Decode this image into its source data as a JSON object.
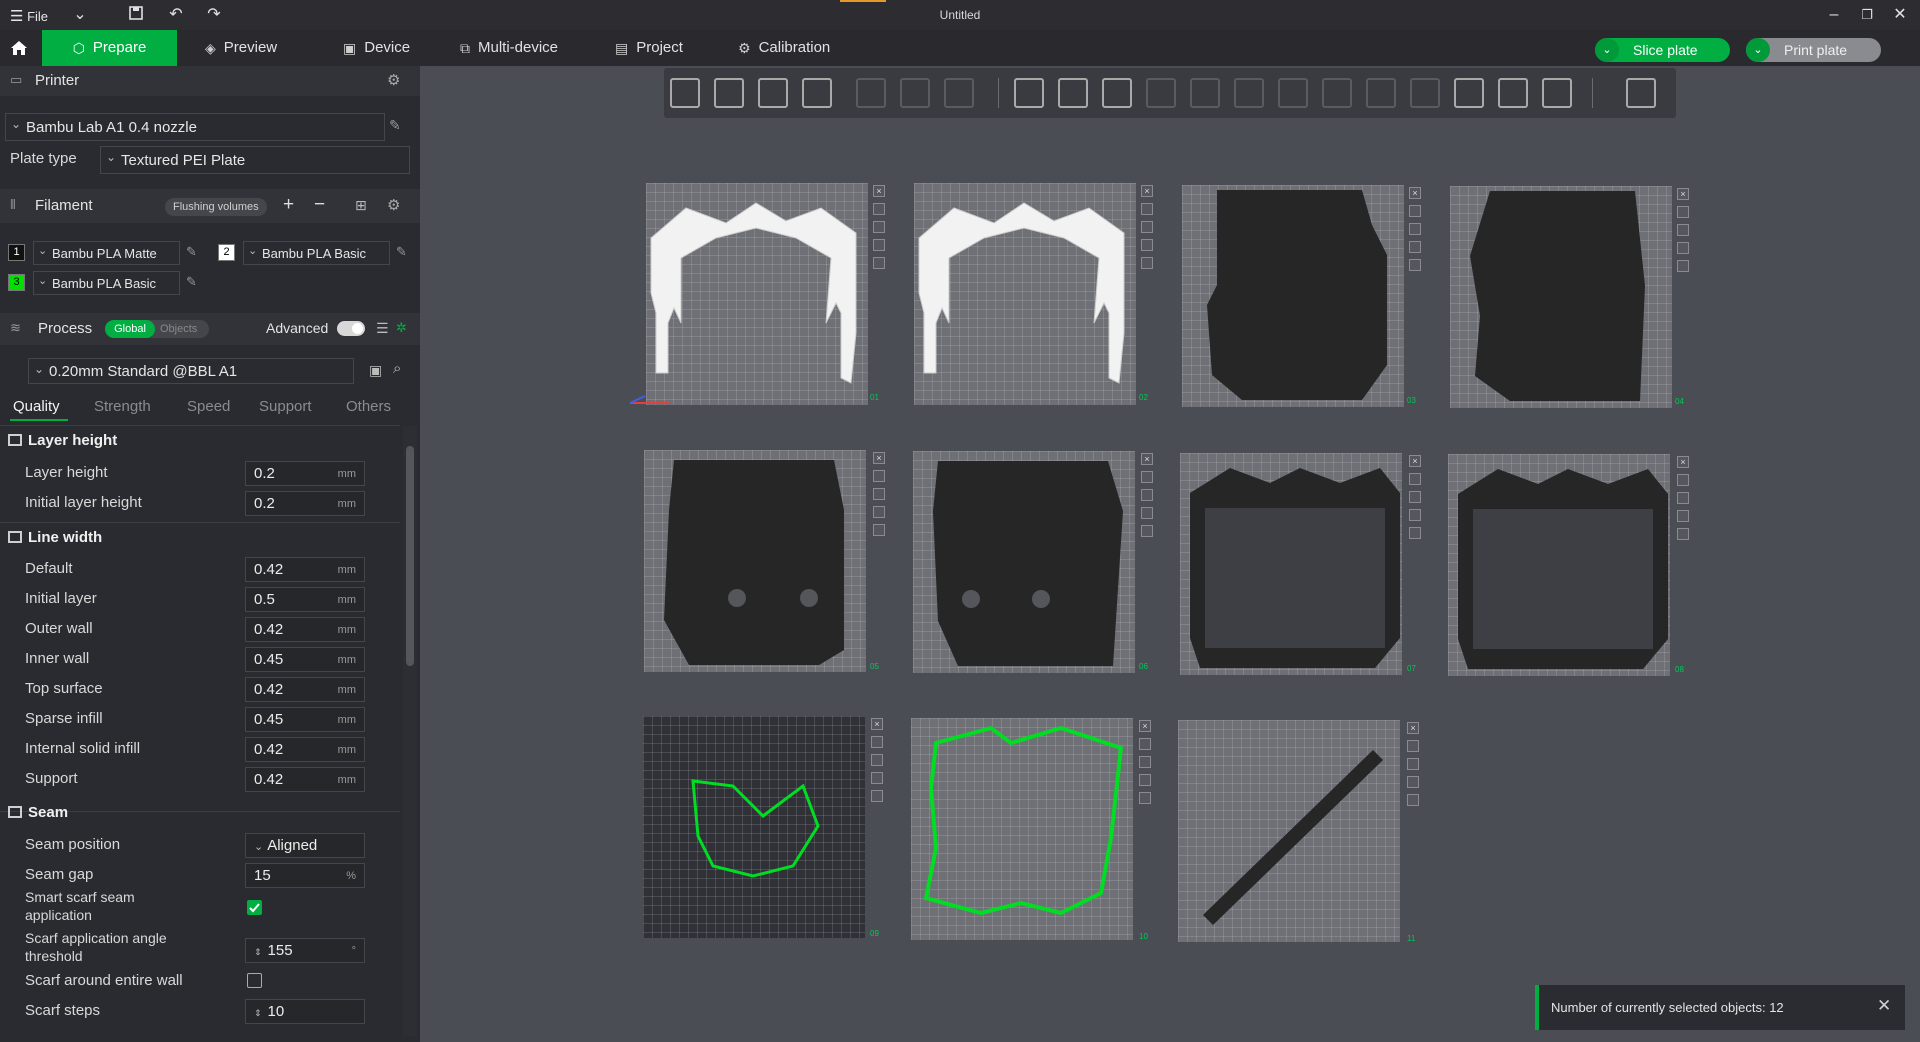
{
  "titlebar": {
    "file_label": "File",
    "window_title": "Untitled"
  },
  "tabs": {
    "prepare": "Prepare",
    "preview": "Preview",
    "device": "Device",
    "multi_device": "Multi-device",
    "project": "Project",
    "calibration": "Calibration"
  },
  "actions": {
    "slice_plate": "Slice plate",
    "print_plate": "Print plate"
  },
  "printer": {
    "header": "Printer",
    "selected": "Bambu Lab A1 0.4 nozzle",
    "plate_type_label": "Plate type",
    "plate_type_value": "Textured PEI Plate"
  },
  "filament": {
    "header": "Filament",
    "flushing_volumes": "Flushing volumes",
    "slots": [
      {
        "num": "1",
        "name": "Bambu PLA Matte",
        "color": "#111111"
      },
      {
        "num": "2",
        "name": "Bambu PLA Basic",
        "color": "#ffffff"
      },
      {
        "num": "3",
        "name": "Bambu PLA Basic",
        "color": "#00e000"
      }
    ]
  },
  "process": {
    "header": "Process",
    "global": "Global",
    "objects": "Objects",
    "advanced": "Advanced",
    "preset": "0.20mm Standard @BBL A1",
    "subtabs": [
      "Quality",
      "Strength",
      "Speed",
      "Support",
      "Others"
    ]
  },
  "quality": {
    "layer_height_group": "Layer height",
    "layer_height": {
      "label": "Layer height",
      "value": "0.2",
      "unit": "mm"
    },
    "initial_layer_height": {
      "label": "Initial layer height",
      "value": "0.2",
      "unit": "mm"
    },
    "line_width_group": "Line width",
    "line_width": [
      {
        "label": "Default",
        "value": "0.42",
        "unit": "mm"
      },
      {
        "label": "Initial layer",
        "value": "0.5",
        "unit": "mm"
      },
      {
        "label": "Outer wall",
        "value": "0.42",
        "unit": "mm"
      },
      {
        "label": "Inner wall",
        "value": "0.45",
        "unit": "mm"
      },
      {
        "label": "Top surface",
        "value": "0.42",
        "unit": "mm"
      },
      {
        "label": "Sparse infill",
        "value": "0.45",
        "unit": "mm"
      },
      {
        "label": "Internal solid infill",
        "value": "0.42",
        "unit": "mm"
      },
      {
        "label": "Support",
        "value": "0.42",
        "unit": "mm"
      }
    ],
    "seam_group": "Seam",
    "seam_position": {
      "label": "Seam position",
      "value": "Aligned"
    },
    "seam_gap": {
      "label": "Seam gap",
      "value": "15",
      "unit": "%"
    },
    "smart_scarf": {
      "label_1": "Smart scarf seam",
      "label_2": "application",
      "checked": true
    },
    "scarf_angle": {
      "label_1": "Scarf application angle",
      "label_2": "threshold",
      "value": "155",
      "unit": "°"
    },
    "scarf_entire_wall": {
      "label": "Scarf around entire wall",
      "checked": false
    },
    "scarf_steps": {
      "label": "Scarf steps",
      "value": "10"
    }
  },
  "plates": [
    "01",
    "02",
    "03",
    "04",
    "05",
    "06",
    "07",
    "08",
    "09",
    "10",
    "11"
  ],
  "toast": {
    "message": "Number of currently selected objects: 12"
  }
}
